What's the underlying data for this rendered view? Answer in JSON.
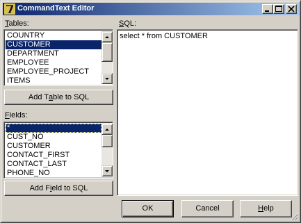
{
  "window": {
    "title": "CommandText Editor",
    "controls": {
      "minimize": "minimize",
      "maximize": "maximize",
      "close": "close"
    }
  },
  "tables": {
    "label_accel": "T",
    "label_rest": "ables:",
    "items": [
      "COUNTRY",
      "CUSTOMER",
      "DEPARTMENT",
      "EMPLOYEE",
      "EMPLOYEE_PROJECT",
      "ITEMS"
    ],
    "selected_index": 1,
    "add_button_pre": "Add T",
    "add_button_accel": "a",
    "add_button_post": "ble to SQL"
  },
  "fields": {
    "label_accel": "F",
    "label_rest": "ields:",
    "items": [
      "*",
      "CUST_NO",
      "CUSTOMER",
      "CONTACT_FIRST",
      "CONTACT_LAST",
      "PHONE_NO"
    ],
    "selected_index": 0,
    "add_button_pre": "Add F",
    "add_button_accel": "i",
    "add_button_post": "eld to SQL"
  },
  "sql": {
    "label_accel": "S",
    "label_rest": "QL:",
    "text": "select * from CUSTOMER"
  },
  "buttons": {
    "ok": "OK",
    "cancel": "Cancel",
    "help_accel": "H",
    "help_rest": "elp"
  },
  "colors": {
    "face": "#d4d0c8",
    "title_start": "#0a246a",
    "title_end": "#a6caf0",
    "selection": "#0a246a"
  },
  "icons": {
    "app": "app-logo-icon",
    "scroll_up": "arrow-up-icon",
    "scroll_down": "arrow-down-icon",
    "size_grip": "size-grip-icon"
  }
}
